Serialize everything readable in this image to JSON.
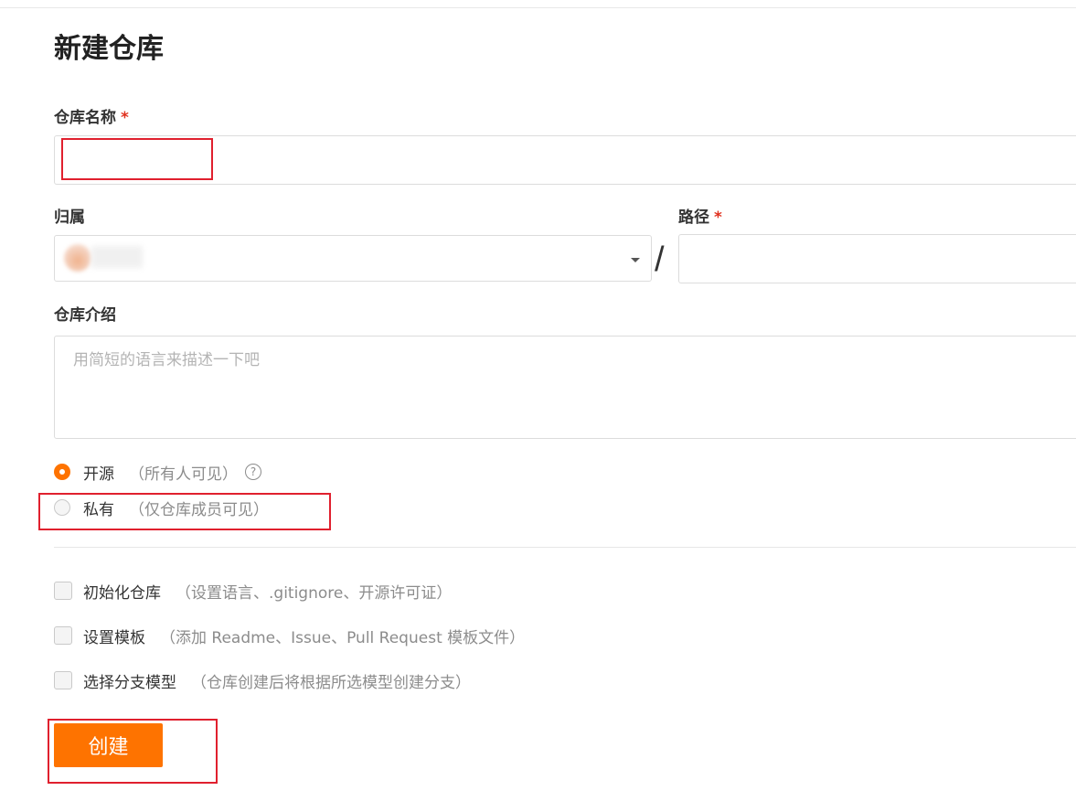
{
  "page": {
    "title": "新建仓库"
  },
  "repo_name": {
    "label": "仓库名称",
    "required_mark": "*",
    "value": ""
  },
  "owner": {
    "label": "归属"
  },
  "path": {
    "label": "路径",
    "required_mark": "*",
    "value": "",
    "separator": "/"
  },
  "description": {
    "label": "仓库介绍",
    "placeholder": "用简短的语言来描述一下吧"
  },
  "visibility": {
    "options": [
      {
        "label": "开源",
        "hint": "（所有人可见）",
        "selected": true
      },
      {
        "label": "私有",
        "hint": "（仅仓库成员可见）",
        "selected": false
      }
    ],
    "help_glyph": "?"
  },
  "extras": [
    {
      "label": "初始化仓库",
      "hint": "（设置语言、.gitignore、开源许可证）",
      "checked": false
    },
    {
      "label": "设置模板",
      "hint": "（添加 Readme、Issue、Pull Request 模板文件）",
      "checked": false
    },
    {
      "label": "选择分支模型",
      "hint": "（仓库创建后将根据所选模型创建分支）",
      "checked": false
    }
  ],
  "submit": {
    "label": "创建"
  },
  "colors": {
    "accent": "#fe7300",
    "highlight_box": "#e0202e"
  }
}
